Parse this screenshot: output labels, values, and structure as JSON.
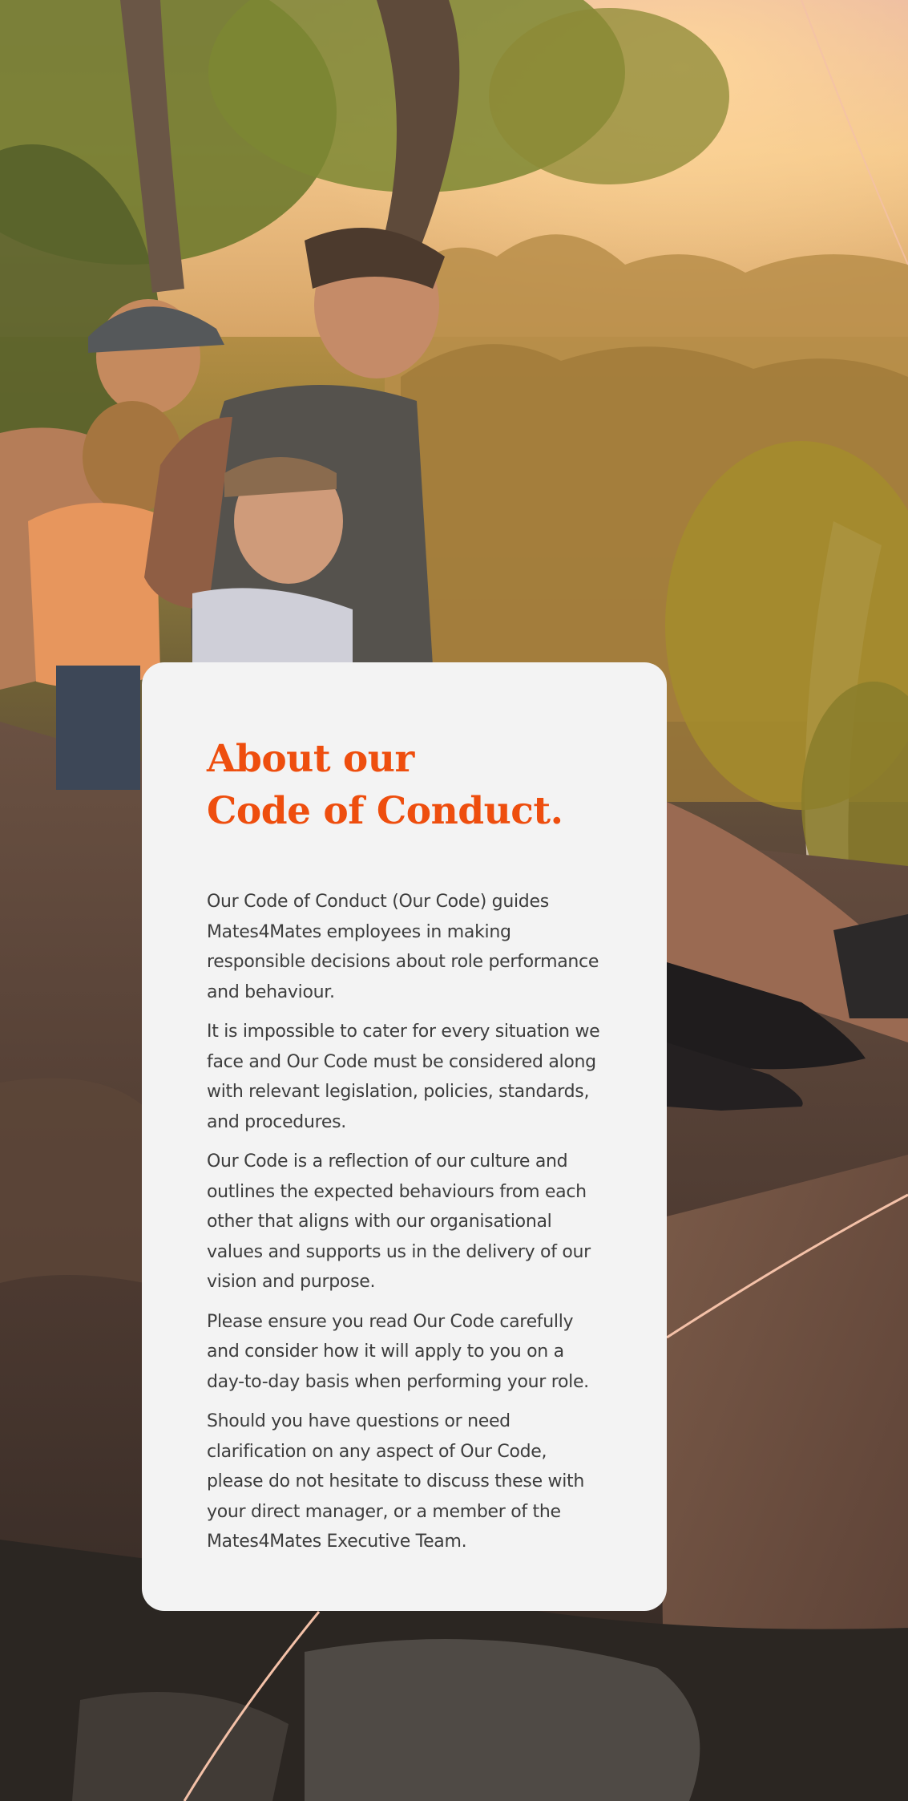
{
  "card": {
    "heading_line1": "About our",
    "heading_line2": "Code of Conduct.",
    "paragraphs": [
      "Our Code of Conduct (Our Code) guides Mates4Mates employees in making responsible decisions about role performance and behaviour.",
      "It is impossible to cater for every situation we face and Our Code must be considered along with relevant legislation, policies, standards, and procedures.",
      "Our Code is a reflection of our culture and outlines the expected behaviours from each other that aligns with our organisational values and supports us in the delivery of our vision and purpose.",
      "Please ensure you read Our Code carefully and consider how it will apply to you on a day-to-day basis when performing your role.",
      "Should you have questions or need clarification on any aspect of Our Code, please do not hesitate to discuss these with your direct manager, or a member of the Mates4Mates Executive Team."
    ]
  },
  "colors": {
    "heading": "#ee4e0e",
    "body_text": "#3d3d3d",
    "card_background": "#f3f3f3",
    "accent_line": "#f4c1a8"
  }
}
